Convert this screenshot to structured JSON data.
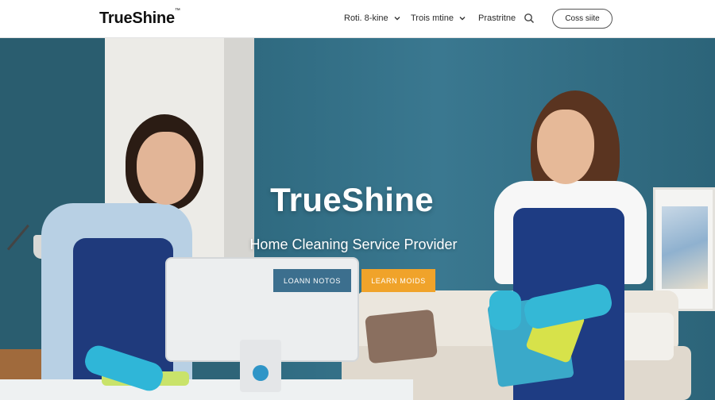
{
  "brand": {
    "name": "TrueShine",
    "trademark": "™"
  },
  "nav": {
    "items": [
      {
        "label": "Roti. 8-kine",
        "has_dropdown": true
      },
      {
        "label": "Trois mtine",
        "has_dropdown": true
      },
      {
        "label": "Prastritne",
        "has_dropdown": false
      }
    ],
    "search_icon": "search-icon",
    "cta_label": "Coss siite"
  },
  "hero": {
    "title": "TrueShine",
    "subtitle": "Home Cleaning Service Provider",
    "primary_button": "LOANN NOTOS",
    "secondary_button": "LEARN MOIDS"
  },
  "colors": {
    "wall": "#2e6478",
    "primary_button": "#3c6f8e",
    "secondary_button": "#f0a32a",
    "header_bg": "#ffffff"
  }
}
